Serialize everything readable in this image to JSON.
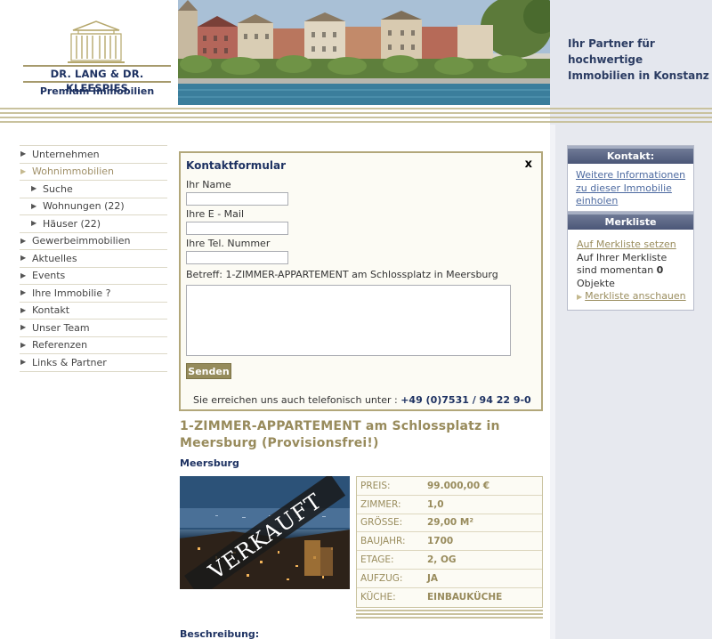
{
  "logo": {
    "name": "DR. LANG & DR. KLEESPIES",
    "sub": "Premium Immobilien"
  },
  "tagline": "Ihr Partner für hochwertige Immobilien in Konstanz",
  "nav": {
    "items": [
      {
        "label": "Unternehmen"
      },
      {
        "label": "Wohnimmobilien"
      },
      {
        "label": "Suche"
      },
      {
        "label": "Wohnungen (22)"
      },
      {
        "label": "Häuser (22)"
      },
      {
        "label": "Gewerbeimmobilien"
      },
      {
        "label": "Aktuelles"
      },
      {
        "label": "Events"
      },
      {
        "label": "Ihre Immobilie ?"
      },
      {
        "label": "Kontakt"
      },
      {
        "label": "Unser Team"
      },
      {
        "label": "Referenzen"
      },
      {
        "label": "Links & Partner"
      }
    ]
  },
  "form": {
    "title": "Kontaktformular",
    "close": "x",
    "name_label": "Ihr Name",
    "email_label": "Ihre E - Mail",
    "phone_label": "Ihre Tel. Nummer",
    "subject": "Betreff: 1-ZIMMER-APPARTEMENT am Schlossplatz in Meersburg",
    "send": "Senden",
    "phone_text": "Sie erreichen uns auch telefonisch unter :",
    "phone_number": "+49 (0)7531 / 94 22 9-0"
  },
  "property": {
    "title": "1-ZIMMER-APPARTEMENT am Schlossplatz in Meersburg (Provisionsfrei!)",
    "location": "Meersburg",
    "stamp": "VERKAUFT",
    "details": [
      {
        "label": "PREIS:",
        "value": "99.000,00 €"
      },
      {
        "label": "ZIMMER:",
        "value": "1,0"
      },
      {
        "label": "GRÖSSE:",
        "value": "29,00 M²"
      },
      {
        "label": "BAUJAHR:",
        "value": "1700"
      },
      {
        "label": "ETAGE:",
        "value": "2, OG"
      },
      {
        "label": "AUFZUG:",
        "value": "JA"
      },
      {
        "label": "KÜCHE:",
        "value": "EINBAUKÜCHE"
      }
    ],
    "desc_label": "Beschreibung:"
  },
  "kontakt_box": {
    "title": "Kontakt:",
    "link": "Weitere Informationen zu dieser Immobilie einholen"
  },
  "merkliste_box": {
    "title": "Merkliste",
    "add_link": "Auf Merkliste setzen",
    "text_before": "Auf Ihrer Merkliste sind momentan",
    "count": "0",
    "text_after": "Objekte",
    "view_link": "Merkliste anschauen"
  },
  "colors": {
    "accent_gold": "#988b5c",
    "navy": "#1e3262",
    "button": "#958b5b"
  }
}
